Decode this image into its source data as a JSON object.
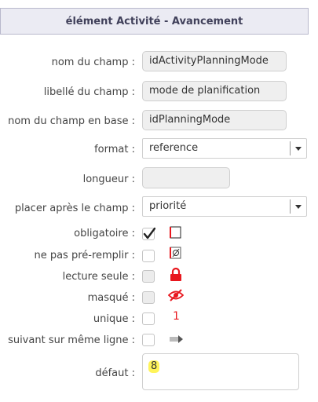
{
  "header": {
    "title": "élément Activité - Avancement"
  },
  "fields": {
    "field_name": {
      "label": "nom du champ :",
      "value": "idActivityPlanningMode"
    },
    "field_label": {
      "label": "libellé du champ :",
      "value": "mode de planification"
    },
    "db_field_name": {
      "label": "nom du champ en base :",
      "value": "idPlanningMode"
    },
    "format": {
      "label": "format :",
      "value": "reference"
    },
    "length": {
      "label": "longueur :",
      "value": ""
    },
    "place_after": {
      "label": "placer après le champ :",
      "value": "priorité"
    },
    "required": {
      "label": "obligatoire :",
      "checked": true
    },
    "no_prefill": {
      "label": "ne pas pré-remplir :",
      "checked": false
    },
    "read_only": {
      "label": "lecture seule :",
      "checked": false
    },
    "hidden": {
      "label": "masqué :",
      "checked": false
    },
    "unique": {
      "label": "unique :",
      "checked": false,
      "indicator": "1"
    },
    "same_line": {
      "label": "suivant sur même ligne :",
      "checked": false
    },
    "default": {
      "label": "défaut :",
      "value": "8"
    }
  },
  "icons": {
    "required": "required-box-icon",
    "no_prefill": "empty-set-icon",
    "read_only": "lock-icon",
    "hidden": "eye-slash-icon",
    "same_line": "arrow-right-icon"
  },
  "colors": {
    "accent_red": "#e8171e",
    "header_bg": "#ebebf3",
    "highlight": "#fff45a"
  }
}
